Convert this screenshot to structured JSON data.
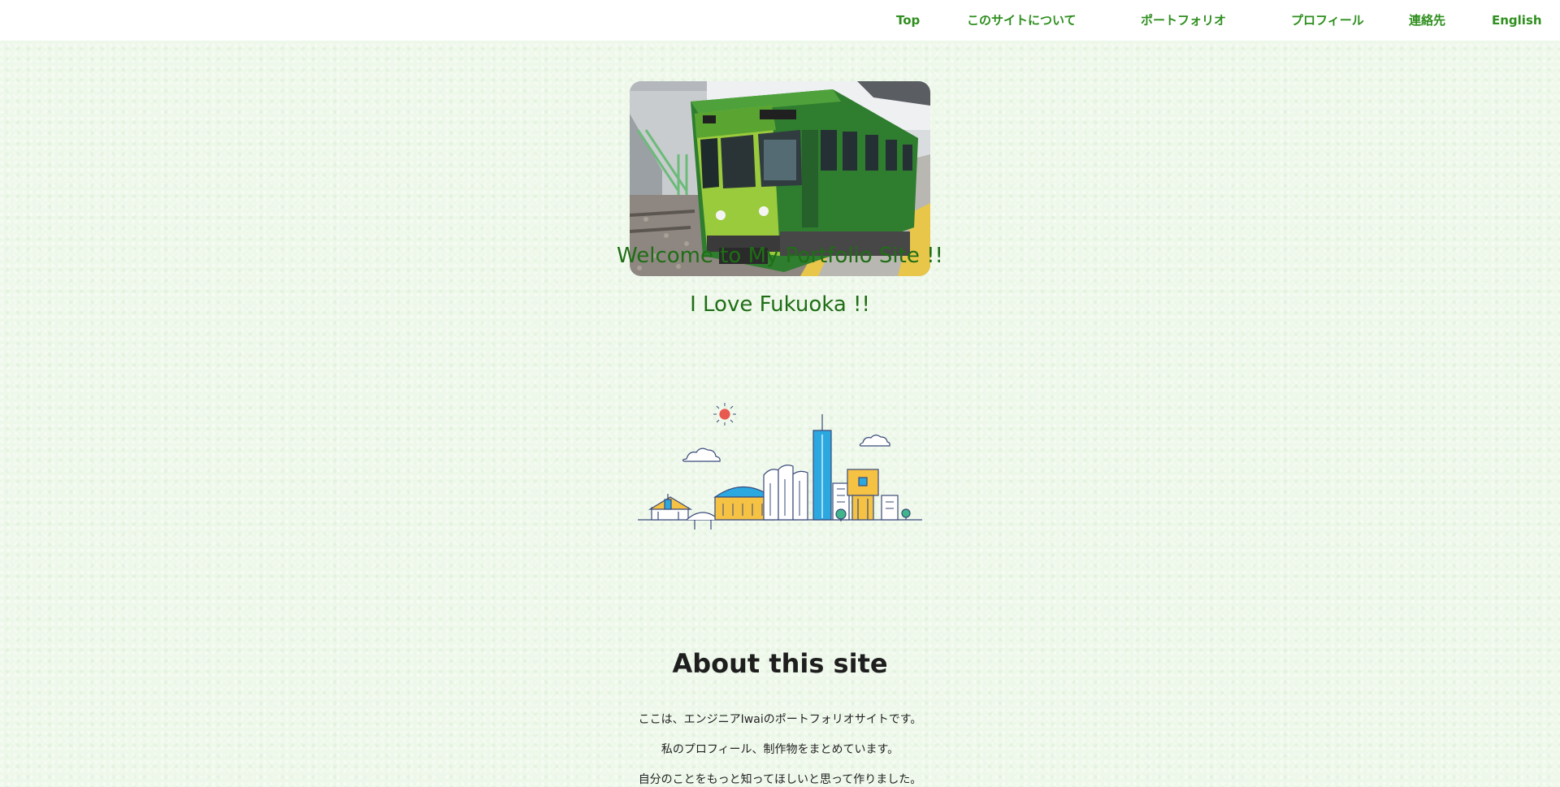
{
  "nav": {
    "items": [
      {
        "label": "Top"
      },
      {
        "label": "このサイトについて"
      },
      {
        "label": "ポートフォリオ"
      },
      {
        "label": "プロフィール"
      },
      {
        "label": "連絡先"
      },
      {
        "label": "English"
      }
    ]
  },
  "hero": {
    "welcome": "Welcome to My Portfolio Site !!",
    "love": "I Love Fukuoka !!"
  },
  "about": {
    "title": "About this site",
    "lines": [
      "ここは、エンジニアIwaiのポートフォリオサイトです。",
      "私のプロフィール、制作物をまとめています。",
      "自分のことをもっと知ってほしいと思って作りました。"
    ]
  },
  "colors": {
    "nav_text": "#2f8f1f",
    "heading_green": "#1f6e16",
    "background": "#eef8ea",
    "accent_yellow": "#f6c244",
    "accent_blue": "#2ba8e0"
  },
  "icons": {
    "hero_photo": "green-train-photo",
    "illustration": "fukuoka-city-skyline-illustration"
  }
}
